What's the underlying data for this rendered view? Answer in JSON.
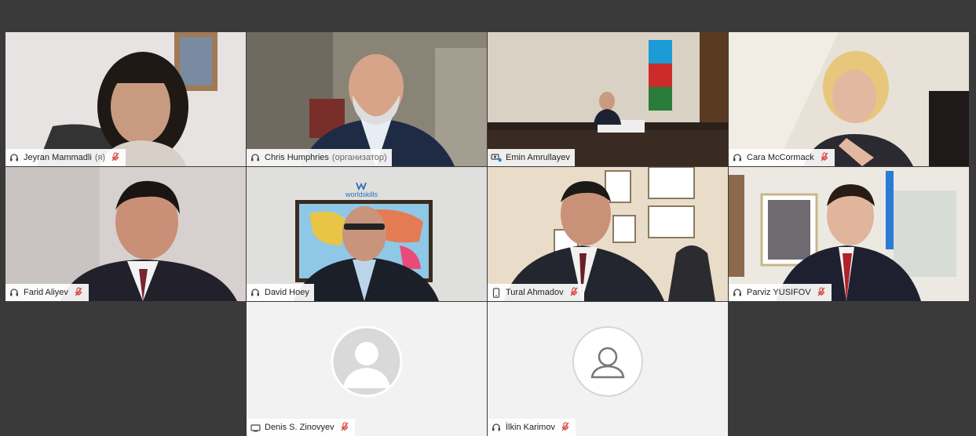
{
  "participants": [
    {
      "name": "Jeyran Mammadli",
      "role": "(я)",
      "device": "headset-icon",
      "muted": true
    },
    {
      "name": "Chris Humphries",
      "role": "(организатор)",
      "device": "headset-icon",
      "muted": false
    },
    {
      "name": "Emin Amrullayev",
      "role": "",
      "device": "room-system-icon",
      "muted": false
    },
    {
      "name": "Cara McCormack",
      "role": "",
      "device": "headset-icon",
      "muted": true
    },
    {
      "name": "Farid Aliyev",
      "role": "",
      "device": "headset-icon",
      "muted": true
    },
    {
      "name": "David Hoey",
      "role": "",
      "device": "headset-icon",
      "muted": false
    },
    {
      "name": "Tural Ahmadov",
      "role": "",
      "device": "phone-icon",
      "muted": true
    },
    {
      "name": "Parviz YUSIFOV",
      "role": "",
      "device": "headset-icon",
      "muted": true
    },
    {
      "name": "Denis S. Zinovyev",
      "role": "",
      "device": "tv-icon",
      "muted": true
    },
    {
      "name": "İlkin Karimov",
      "role": "",
      "device": "headset-icon",
      "muted": true
    }
  ],
  "scene_text": {
    "worldskills_logo": "worldskills"
  },
  "colors": {
    "background": "#3a3a3a",
    "tile_empty": "#f2f2f2",
    "mute_red": "#d9342b",
    "label_bg": "#ffffff"
  }
}
